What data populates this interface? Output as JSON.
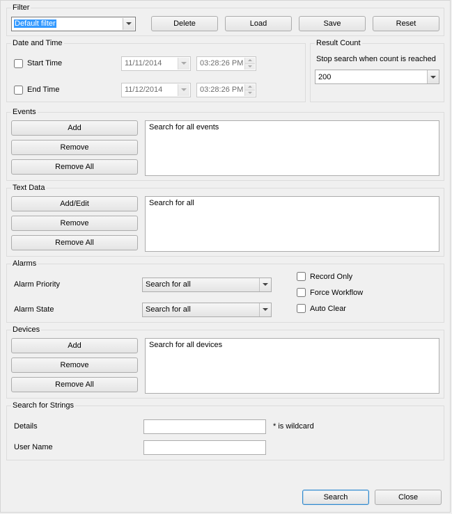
{
  "filter": {
    "legend": "Filter",
    "selected": "Default filter",
    "buttons": {
      "delete": "Delete",
      "load": "Load",
      "save": "Save",
      "reset": "Reset"
    }
  },
  "datetime": {
    "legend": "Date and Time",
    "start_label": "Start Time",
    "end_label": "End Time",
    "start_date": "11/11/2014",
    "start_time": "03:28:26 PM",
    "end_date": "11/12/2014",
    "end_time": "03:28:26 PM"
  },
  "result": {
    "legend": "Result Count",
    "text": "Stop search when count is reached",
    "value": "200"
  },
  "events": {
    "legend": "Events",
    "add": "Add",
    "remove": "Remove",
    "remove_all": "Remove All",
    "list_text": "Search for all events"
  },
  "textdata": {
    "legend": "Text Data",
    "addedit": "Add/Edit",
    "remove": "Remove",
    "remove_all": "Remove All",
    "list_text": "Search for all"
  },
  "alarms": {
    "legend": "Alarms",
    "priority_label": "Alarm Priority",
    "state_label": "Alarm State",
    "priority_value": "Search for all",
    "state_value": "Search for all",
    "record_only": "Record Only",
    "force_workflow": "Force Workflow",
    "auto_clear": "Auto Clear"
  },
  "devices": {
    "legend": "Devices",
    "add": "Add",
    "remove": "Remove",
    "remove_all": "Remove All",
    "list_text": "Search for all devices"
  },
  "strings": {
    "legend": "Search for Strings",
    "details_label": "Details",
    "username_label": "User Name",
    "details_value": "",
    "username_value": "",
    "wildcard_hint": "* is wildcard"
  },
  "footer": {
    "search": "Search",
    "close": "Close"
  }
}
